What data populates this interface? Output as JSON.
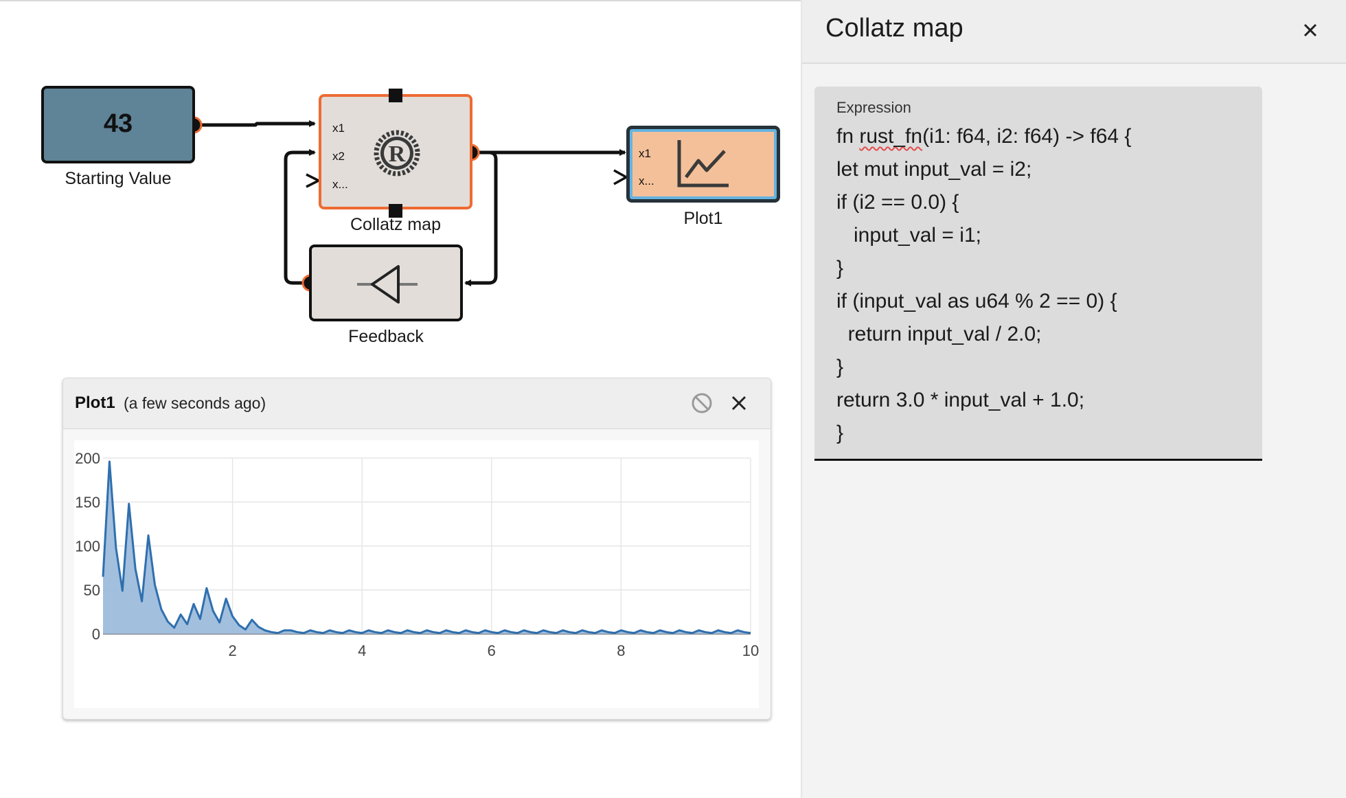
{
  "blocks": {
    "starting_value": {
      "value": "43",
      "label": "Starting Value"
    },
    "collatz": {
      "label": "Collatz map",
      "ports": [
        "x1",
        "x2",
        "x..."
      ]
    },
    "feedback": {
      "label": "Feedback"
    },
    "plot": {
      "label": "Plot1",
      "ports": [
        "x1",
        "x..."
      ]
    }
  },
  "icons": {
    "collatz": "rust-logo-icon",
    "feedback": "feedback-triangle-icon",
    "plot": "line-chart-icon",
    "disable": "block-icon",
    "close": "close-icon"
  },
  "plot_panel": {
    "title": "Plot1",
    "subtitle": "(a few seconds ago)"
  },
  "side_panel": {
    "title": "Collatz map",
    "expression_label": "Expression",
    "code": {
      "prefix": "fn ",
      "fn_name": "rust_fn",
      "suffix": "(i1: f64, i2: f64) -> f64 {",
      "lines": [
        "let mut input_val = i2;",
        "if (i2 == 0.0) {",
        "   input_val = i1;",
        "}",
        "if (input_val as u64 % 2 == 0) {",
        "  return input_val / 2.0;",
        "}",
        "return 3.0 * input_val + 1.0;",
        "}"
      ]
    }
  },
  "colors": {
    "starting_value_fill": "#5f8397",
    "collatz_border": "#ee6b32",
    "block_fill": "#e2ddd9",
    "plot_fill": "#f4c09a",
    "line": "#2f6fae",
    "area": "#9dbcdc"
  },
  "chart_data": {
    "type": "area",
    "x_ticks": [
      "2",
      "4",
      "6",
      "8",
      "10"
    ],
    "y_ticks": [
      "0",
      "50",
      "100",
      "150",
      "200"
    ],
    "xlim": [
      0,
      10
    ],
    "ylim": [
      0,
      200
    ],
    "grid": true,
    "x": [
      0,
      0.1,
      0.2,
      0.3,
      0.4,
      0.5,
      0.6,
      0.7,
      0.8,
      0.9,
      1.0,
      1.1,
      1.2,
      1.3,
      1.4,
      1.5,
      1.6,
      1.7,
      1.8,
      1.9,
      2.0,
      2.1,
      2.2,
      2.3,
      2.4,
      2.5,
      2.6,
      2.7,
      2.8
    ],
    "y": [
      65,
      196,
      98,
      49,
      148,
      74,
      37,
      112,
      56,
      28,
      14,
      7,
      22,
      11,
      34,
      17,
      52,
      26,
      13,
      40,
      20,
      10,
      5,
      16,
      8,
      4,
      2,
      1,
      4
    ],
    "tail": {
      "from": 2.8,
      "to": 10,
      "step": 0.1,
      "pattern": [
        4,
        2,
        1
      ]
    }
  }
}
